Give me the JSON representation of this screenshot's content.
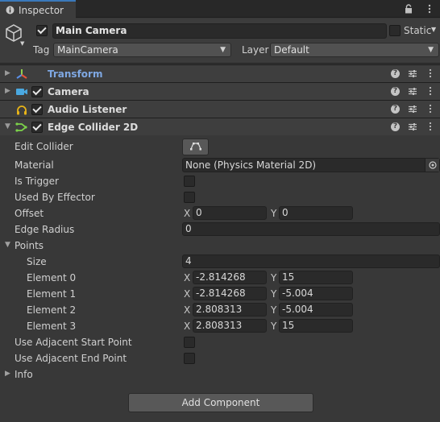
{
  "tab": {
    "title": "Inspector",
    "icon": "info-icon"
  },
  "tab_actions": [
    "lock-icon",
    "kebab-menu-icon"
  ],
  "gameobject": {
    "name": "Main Camera",
    "active": true,
    "static_label": "Static",
    "static": false,
    "tag_label": "Tag",
    "tag": "MainCamera",
    "layer_label": "Layer",
    "layer": "Default"
  },
  "components": [
    {
      "title": "Transform",
      "icon": "transform-icon",
      "expanded": false,
      "has_toggle": false
    },
    {
      "title": "Camera",
      "icon": "camera-icon",
      "expanded": false,
      "has_toggle": true,
      "enabled": true
    },
    {
      "title": "Audio Listener",
      "icon": "headphones-icon",
      "expanded": false,
      "has_toggle": true,
      "enabled": true
    },
    {
      "title": "Edge Collider 2D",
      "icon": "edge-collider-icon",
      "expanded": true,
      "has_toggle": true,
      "enabled": true
    }
  ],
  "edge_collider": {
    "edit_collider_label": "Edit Collider",
    "material_label": "Material",
    "material_value": "None (Physics Material 2D)",
    "is_trigger_label": "Is Trigger",
    "used_by_effector_label": "Used By Effector",
    "offset_label": "Offset",
    "offset": {
      "x": "0",
      "y": "0"
    },
    "edge_radius_label": "Edge Radius",
    "edge_radius": "0",
    "points_label": "Points",
    "size_label": "Size",
    "size": "4",
    "elements": [
      {
        "label": "Element 0",
        "x": "-2.814268",
        "y": "15"
      },
      {
        "label": "Element 1",
        "x": "-2.814268",
        "y": "-5.004"
      },
      {
        "label": "Element 2",
        "x": "2.808313",
        "y": "-5.004"
      },
      {
        "label": "Element 3",
        "x": "2.808313",
        "y": "15"
      }
    ],
    "adj_start_label": "Use Adjacent Start Point",
    "adj_end_label": "Use Adjacent End Point",
    "info_label": "Info"
  },
  "axis": {
    "x": "X",
    "y": "Y"
  },
  "add_component": "Add Component",
  "colors": {
    "accent": "#3a79bb",
    "transform_title": "#7fa8e3",
    "panel": "#383838"
  }
}
